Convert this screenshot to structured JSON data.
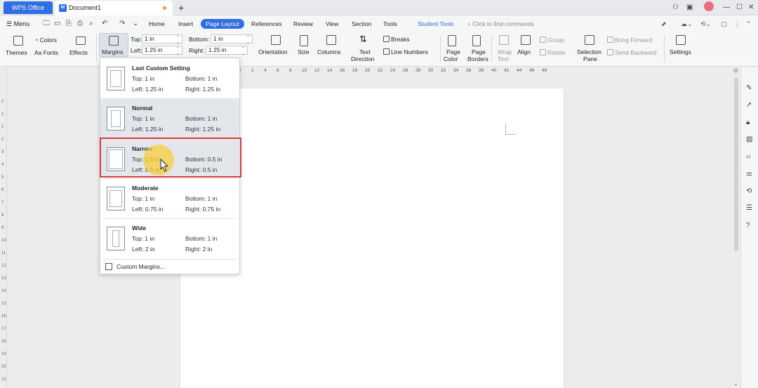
{
  "titlebar": {
    "app_tab": "WPS Office",
    "doc_tab": "Document1",
    "new_tab": "+"
  },
  "tabrow": {
    "menu_label": "Menu",
    "tabs": [
      "Home",
      "Insert",
      "Page Layout",
      "References",
      "Review",
      "View",
      "Section",
      "Tools"
    ],
    "active_tab": "Page Layout",
    "special_tab": "Student Tools",
    "search_placeholder": "Click to find commands"
  },
  "ribbon": {
    "themes": "Themes",
    "colors": "Colors",
    "fonts": "Fonts",
    "effects": "Effects",
    "margins": "Margins",
    "top_label": "Top:",
    "top_value": "1 in",
    "bottom_label": "Bottom:",
    "bottom_value": "1 in",
    "left_label": "Left:",
    "left_value": "1.25 in",
    "right_label": "Right:",
    "right_value": "1.25 in",
    "orientation": "Orientation",
    "size": "Size",
    "columns": "Columns",
    "text_direction_1": "Text",
    "text_direction_2": "Direction",
    "breaks": "Breaks",
    "line_numbers": "Line Numbers",
    "page_color_1": "Page",
    "page_color_2": "Color",
    "page_borders_1": "Page",
    "page_borders_2": "Borders",
    "wrap_text_1": "Wrap",
    "wrap_text_2": "Text",
    "align": "Align",
    "group": "Group",
    "rotate": "Rotate",
    "selection_pane_1": "Selection",
    "selection_pane_2": "Pane",
    "bring_forward": "Bring Forward",
    "send_backward": "Send Backward",
    "settings": "Settings"
  },
  "ruler": {
    "h_ticks": [
      "2",
      "2",
      "4",
      "6",
      "8",
      "10",
      "12",
      "14",
      "16",
      "18",
      "20",
      "22",
      "24",
      "26",
      "28",
      "30",
      "32",
      "34",
      "36",
      "38",
      "40",
      "42",
      "44",
      "46",
      "48"
    ],
    "v_ticks": [
      "2",
      "1",
      "1",
      "2",
      "3",
      "4",
      "5",
      "6",
      "7",
      "8",
      "9",
      "10",
      "11",
      "12",
      "13",
      "14",
      "15",
      "16",
      "17",
      "18",
      "19",
      "20",
      "21"
    ]
  },
  "margins_menu": {
    "options": [
      {
        "title": "Last Custom Setting",
        "top": "Top: 1 in",
        "bottom": "Bottom: 1 in",
        "left": "Left: 1.25 in",
        "right": "Right: 1.25 in"
      },
      {
        "title": "Normal",
        "top": "Top: 1 in",
        "bottom": "Bottom: 1 in",
        "left": "Left: 1.25 in",
        "right": "Right: 1.25 in"
      },
      {
        "title": "Narrow",
        "top": "Top: 0.5 in",
        "bottom": "Bottom: 0.5 in",
        "left": "Left: 0.5 in",
        "right": "Right: 0.5 in"
      },
      {
        "title": "Moderate",
        "top": "Top: 1 in",
        "bottom": "Bottom: 1 in",
        "left": "Left: 0.75 in",
        "right": "Right: 0.75 in"
      },
      {
        "title": "Wide",
        "top": "Top: 1 in",
        "bottom": "Bottom: 1 in",
        "left": "Left: 2 in",
        "right": "Right: 2 in"
      }
    ],
    "custom": "Custom Margins...",
    "accent_color": "#e03a3a"
  },
  "colors": {
    "brand": "#2f6ee6",
    "cursor_highlight": "#facd3c"
  }
}
